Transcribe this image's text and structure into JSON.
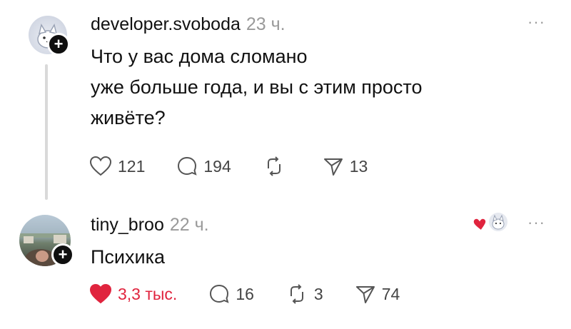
{
  "posts": [
    {
      "username": "developer.svoboda",
      "time": "23 ч.",
      "text_lines": [
        "Что у вас дома сломано",
        "уже больше года, и вы с этим просто",
        "живёте?"
      ],
      "likes": "121",
      "replies": "194",
      "reposts": "",
      "shares": "13",
      "liked": false
    },
    {
      "username": "tiny_broo",
      "time": "22 ч.",
      "text_lines": [
        "Психика"
      ],
      "likes": "3,3 тыс.",
      "replies": "16",
      "reposts": "3",
      "shares": "74",
      "liked": true
    }
  ],
  "more_label": "···",
  "follow_label": "+",
  "colors": {
    "like_active": "#e0243e",
    "muted": "#9a9a9a",
    "text": "#111111"
  }
}
